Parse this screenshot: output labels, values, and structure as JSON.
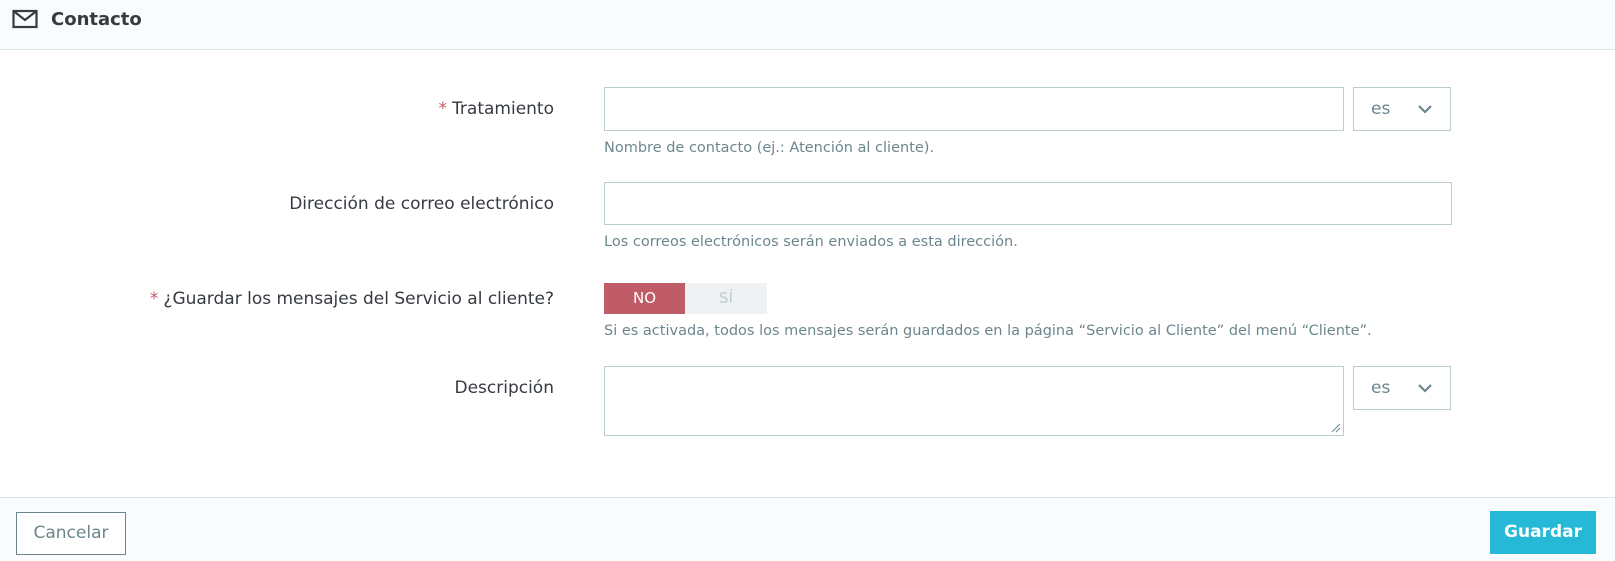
{
  "header": {
    "title": "Contacto",
    "icon": "envelope-icon"
  },
  "form": {
    "title_field": {
      "required_mark": "*",
      "label": "Tratamiento",
      "value": "",
      "language": "es",
      "help": "Nombre de contacto (ej.: Atención al cliente)."
    },
    "email_field": {
      "label": "Dirección de correo electrónico",
      "value": "",
      "help": "Los correos electrónicos serán enviados a esta dirección."
    },
    "save_messages_field": {
      "required_mark": "*",
      "label": "¿Guardar los mensajes del Servicio al cliente?",
      "no_label": "NO",
      "yes_label": "SÍ",
      "selected": "NO",
      "help": "Si es activada, todos los mensajes serán guardados en la página “Servicio al Cliente” del menú “Cliente”."
    },
    "description_field": {
      "label": "Descripción",
      "value": "",
      "language": "es"
    }
  },
  "footer": {
    "cancel_label": "Cancelar",
    "save_label": "Guardar"
  },
  "colors": {
    "accent": "#25b9d7",
    "danger": "#c05c67",
    "text": "#363a41",
    "muted": "#6c868e",
    "border": "#bbcdd2"
  }
}
